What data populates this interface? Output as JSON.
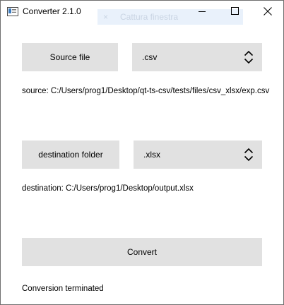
{
  "window": {
    "title": "Converter 2.1.0",
    "ghost_tooltip": {
      "close_glyph": "×",
      "text": "Cattura finestra"
    }
  },
  "source": {
    "button_label": "Source file",
    "format_selected": ".csv",
    "path_text": "source: C:/Users/prog1/Desktop/qt-ts-csv/tests/files/csv_xlsx/exp.csv"
  },
  "destination": {
    "button_label": "destination folder",
    "format_selected": ".xlsx",
    "path_text": "destination: C:/Users/prog1/Desktop/output.xlsx"
  },
  "convert": {
    "button_label": "Convert"
  },
  "status": {
    "text": "Conversion terminated"
  },
  "icons": {
    "app": "app-window-icon",
    "minimize": "minimize-icon",
    "maximize": "maximize-icon",
    "close": "close-icon",
    "combo_arrows": "up-down-chevron-icon"
  },
  "colors": {
    "button_bg": "#e1e1e1",
    "window_bg": "#ffffff",
    "ghost_tooltip_bg": "#e9f1fb"
  }
}
